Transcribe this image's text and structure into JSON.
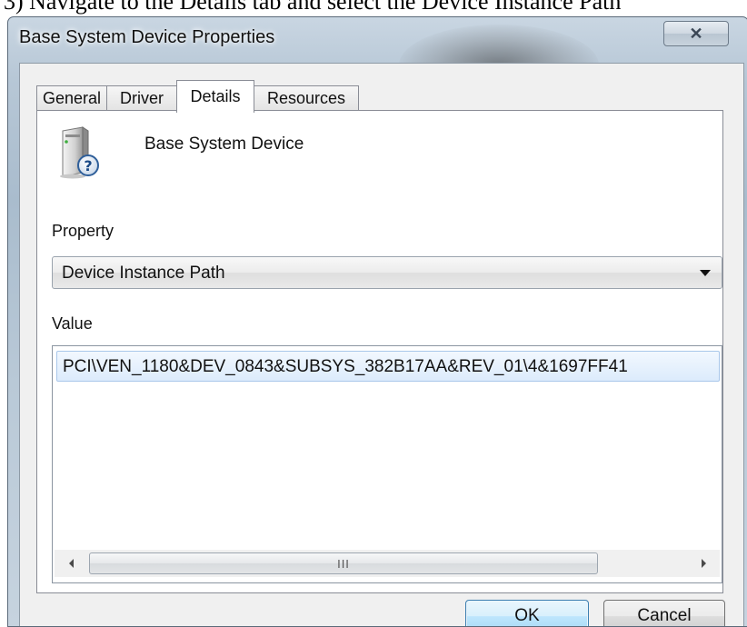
{
  "page_caption": "3) Navigate to the Details tab and select the Device Instance Path",
  "window": {
    "title": "Base System Device Properties",
    "close_glyph": "✕"
  },
  "tabs": [
    {
      "label": "General",
      "active": false
    },
    {
      "label": "Driver",
      "active": false
    },
    {
      "label": "Details",
      "active": true
    },
    {
      "label": "Resources",
      "active": false
    }
  ],
  "device": {
    "name": "Base System Device",
    "icon": "unknown-device-icon"
  },
  "property": {
    "label": "Property",
    "selected": "Device Instance Path"
  },
  "value": {
    "label": "Value",
    "items": [
      "PCI\\VEN_1180&DEV_0843&SUBSYS_382B17AA&REV_01\\4&1697FF41"
    ]
  },
  "scrollbar": {
    "grip": "III"
  },
  "buttons": {
    "ok": "OK",
    "cancel": "Cancel"
  },
  "colors": {
    "selection_fill": "#dcebfc",
    "selection_border": "#a9c7ea",
    "ok_border": "#3c7fb1"
  }
}
